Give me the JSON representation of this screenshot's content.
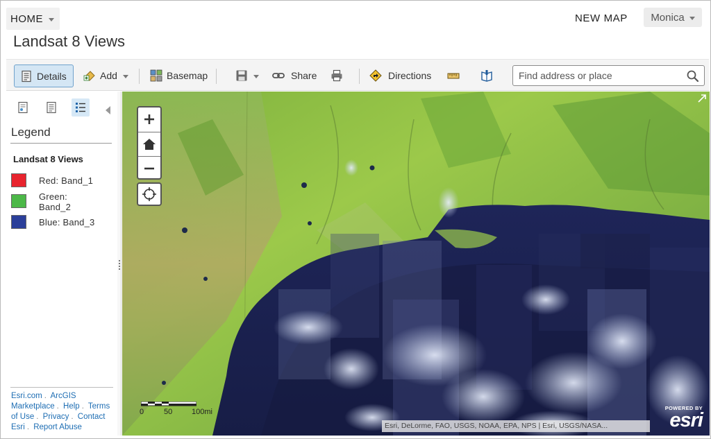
{
  "header": {
    "home_label": "HOME",
    "new_map_label": "NEW MAP",
    "user_name": "Monica"
  },
  "page": {
    "title": "Landsat 8 Views"
  },
  "toolbar": {
    "details_label": "Details",
    "add_label": "Add",
    "basemap_label": "Basemap",
    "share_label": "Share",
    "directions_label": "Directions",
    "search_placeholder": "Find address or place"
  },
  "sidebar": {
    "legend_heading": "Legend",
    "layer_title": "Landsat 8 Views",
    "legend_items": [
      {
        "label": "Red: Band_1",
        "color": "#e8242e"
      },
      {
        "label": "Green:\nBand_2",
        "color": "#4cb848"
      },
      {
        "label": "Blue: Band_3",
        "color": "#2b3f9a"
      }
    ],
    "footer": {
      "links": [
        "Esri.com",
        "ArcGIS Marketplace",
        "Help",
        "Terms of Use",
        "Privacy",
        "Contact Esri",
        "Report Abuse"
      ]
    }
  },
  "map": {
    "zoom_in_symbol": "+",
    "zoom_out_symbol": "−",
    "scale_labels": [
      "0",
      "50",
      "100mi"
    ],
    "attribution": "Esri, DeLorme, FAO, USGS, NOAA, EPA, NPS | Esri, USGS/NASA...",
    "logo_powered": "POWERED BY",
    "logo_text": "esri"
  },
  "icons": {
    "details": "details-icon",
    "add": "add-icon",
    "basemap": "basemap-icon",
    "save": "save-icon",
    "share": "share-icon",
    "print": "print-icon",
    "directions": "directions-icon",
    "measure": "measure-icon",
    "bookmarks": "bookmarks-icon",
    "search": "search-icon"
  }
}
